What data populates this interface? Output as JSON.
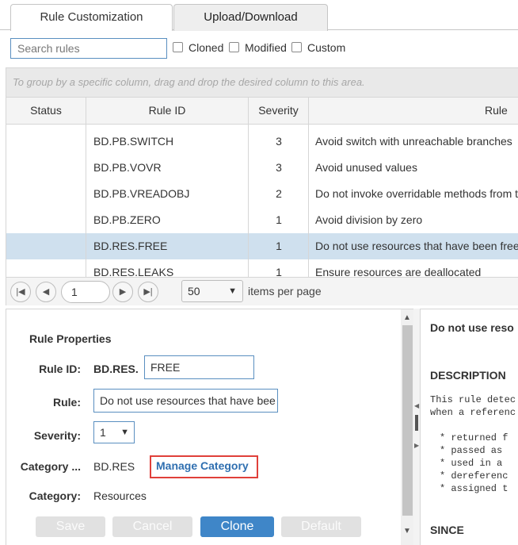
{
  "tabs": [
    {
      "label": "Rule Customization"
    },
    {
      "label": "Upload/Download"
    }
  ],
  "filters": {
    "search_placeholder": "Search rules",
    "checkboxes": [
      {
        "label": "Cloned",
        "checked": false
      },
      {
        "label": "Modified",
        "checked": false
      },
      {
        "label": "Custom",
        "checked": false
      }
    ]
  },
  "grid": {
    "group_hint": "To group by a specific column, drag and drop the desired column to this area.",
    "columns": [
      "Status",
      "Rule ID",
      "Severity",
      "Rule"
    ],
    "rows": [
      {
        "status": "",
        "rule_id": "BD.PB.SWITCH",
        "severity": "3",
        "rule": "Avoid switch with unreachable branches"
      },
      {
        "status": "",
        "rule_id": "BD.PB.VOVR",
        "severity": "3",
        "rule": "Avoid unused values"
      },
      {
        "status": "",
        "rule_id": "BD.PB.VREADOBJ",
        "severity": "2",
        "rule": "Do not invoke overridable methods from th"
      },
      {
        "status": "",
        "rule_id": "BD.PB.ZERO",
        "severity": "1",
        "rule": "Avoid division by zero"
      },
      {
        "status": "",
        "rule_id": "BD.RES.FREE",
        "severity": "1",
        "rule": "Do not use resources that have been freed",
        "selected": true
      },
      {
        "status": "",
        "rule_id": "BD.RES.LEAKS",
        "severity": "1",
        "rule": "Ensure resources are deallocated"
      }
    ]
  },
  "pager": {
    "first": "|◀",
    "prev": "◀",
    "next": "▶",
    "last": "▶|",
    "page": "1",
    "page_size": "50",
    "items_label": "items per page"
  },
  "properties": {
    "title": "Rule Properties",
    "rule_id_label": "Rule ID:",
    "rule_id_prefix": "BD.RES.",
    "rule_id_value": "FREE",
    "rule_label": "Rule:",
    "rule_value": "Do not use resources that have bee",
    "severity_label": "Severity:",
    "severity_value": "1",
    "category_id_label": "Category ...",
    "category_id_value": "BD.RES",
    "manage_category": "Manage Category",
    "category_label": "Category:",
    "category_value": "Resources",
    "buttons": {
      "save": "Save",
      "cancel": "Cancel",
      "clone": "Clone",
      "default": "Default"
    }
  },
  "description": {
    "title": "Do not use reso",
    "heading": "DESCRIPTION",
    "line1": "This rule detec",
    "line2": "when a referenc",
    "bullets": [
      "* returned f",
      "* passed as",
      "* used in a",
      "* dereferenc",
      "* assigned t"
    ],
    "since": "SINCE"
  },
  "colors": {
    "accent": "#3f86c8",
    "selected_row": "#cfe0ee",
    "highlight": "#e0403a",
    "link": "#2f6fb0"
  }
}
